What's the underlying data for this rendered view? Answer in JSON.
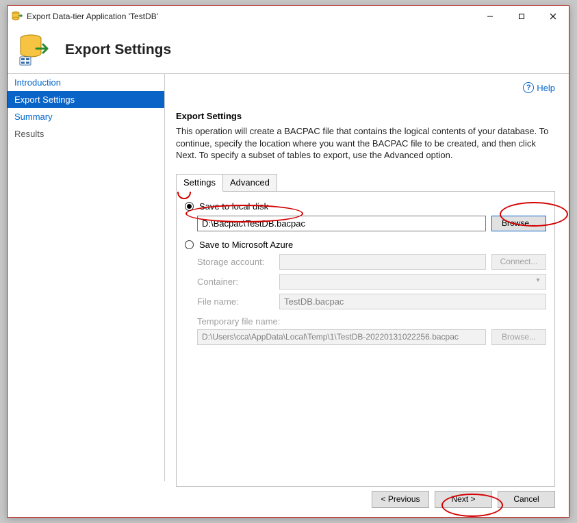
{
  "window": {
    "title": "Export Data-tier Application 'TestDB'"
  },
  "header": {
    "title": "Export Settings"
  },
  "sidebar": {
    "items": [
      {
        "label": "Introduction"
      },
      {
        "label": "Export Settings"
      },
      {
        "label": "Summary"
      },
      {
        "label": "Results"
      }
    ]
  },
  "help": {
    "label": "Help"
  },
  "main": {
    "section_title": "Export Settings",
    "description": "This operation will create a BACPAC file that contains the logical contents of your database. To continue, specify the location where you want the BACPAC file to be created, and then click Next. To specify a subset of tables to export, use the Advanced option.",
    "tabs": [
      {
        "label": "Settings"
      },
      {
        "label": "Advanced"
      }
    ],
    "save_local_label": "Save to local disk",
    "local_path": "D:\\Bacpac\\TestDB.bacpac",
    "browse_label": "Browse...",
    "save_azure_label": "Save to Microsoft Azure",
    "storage_account_label": "Storage account:",
    "storage_account_value": "",
    "connect_label": "Connect...",
    "container_label": "Container:",
    "container_value": "",
    "file_name_label": "File name:",
    "file_name_value": "TestDB.bacpac",
    "temp_label": "Temporary file name:",
    "temp_value": "D:\\Users\\cca\\AppData\\Local\\Temp\\1\\TestDB-20220131022256.bacpac",
    "browse2_label": "Browse..."
  },
  "footer": {
    "previous": "< Previous",
    "next": "Next >",
    "cancel": "Cancel"
  }
}
